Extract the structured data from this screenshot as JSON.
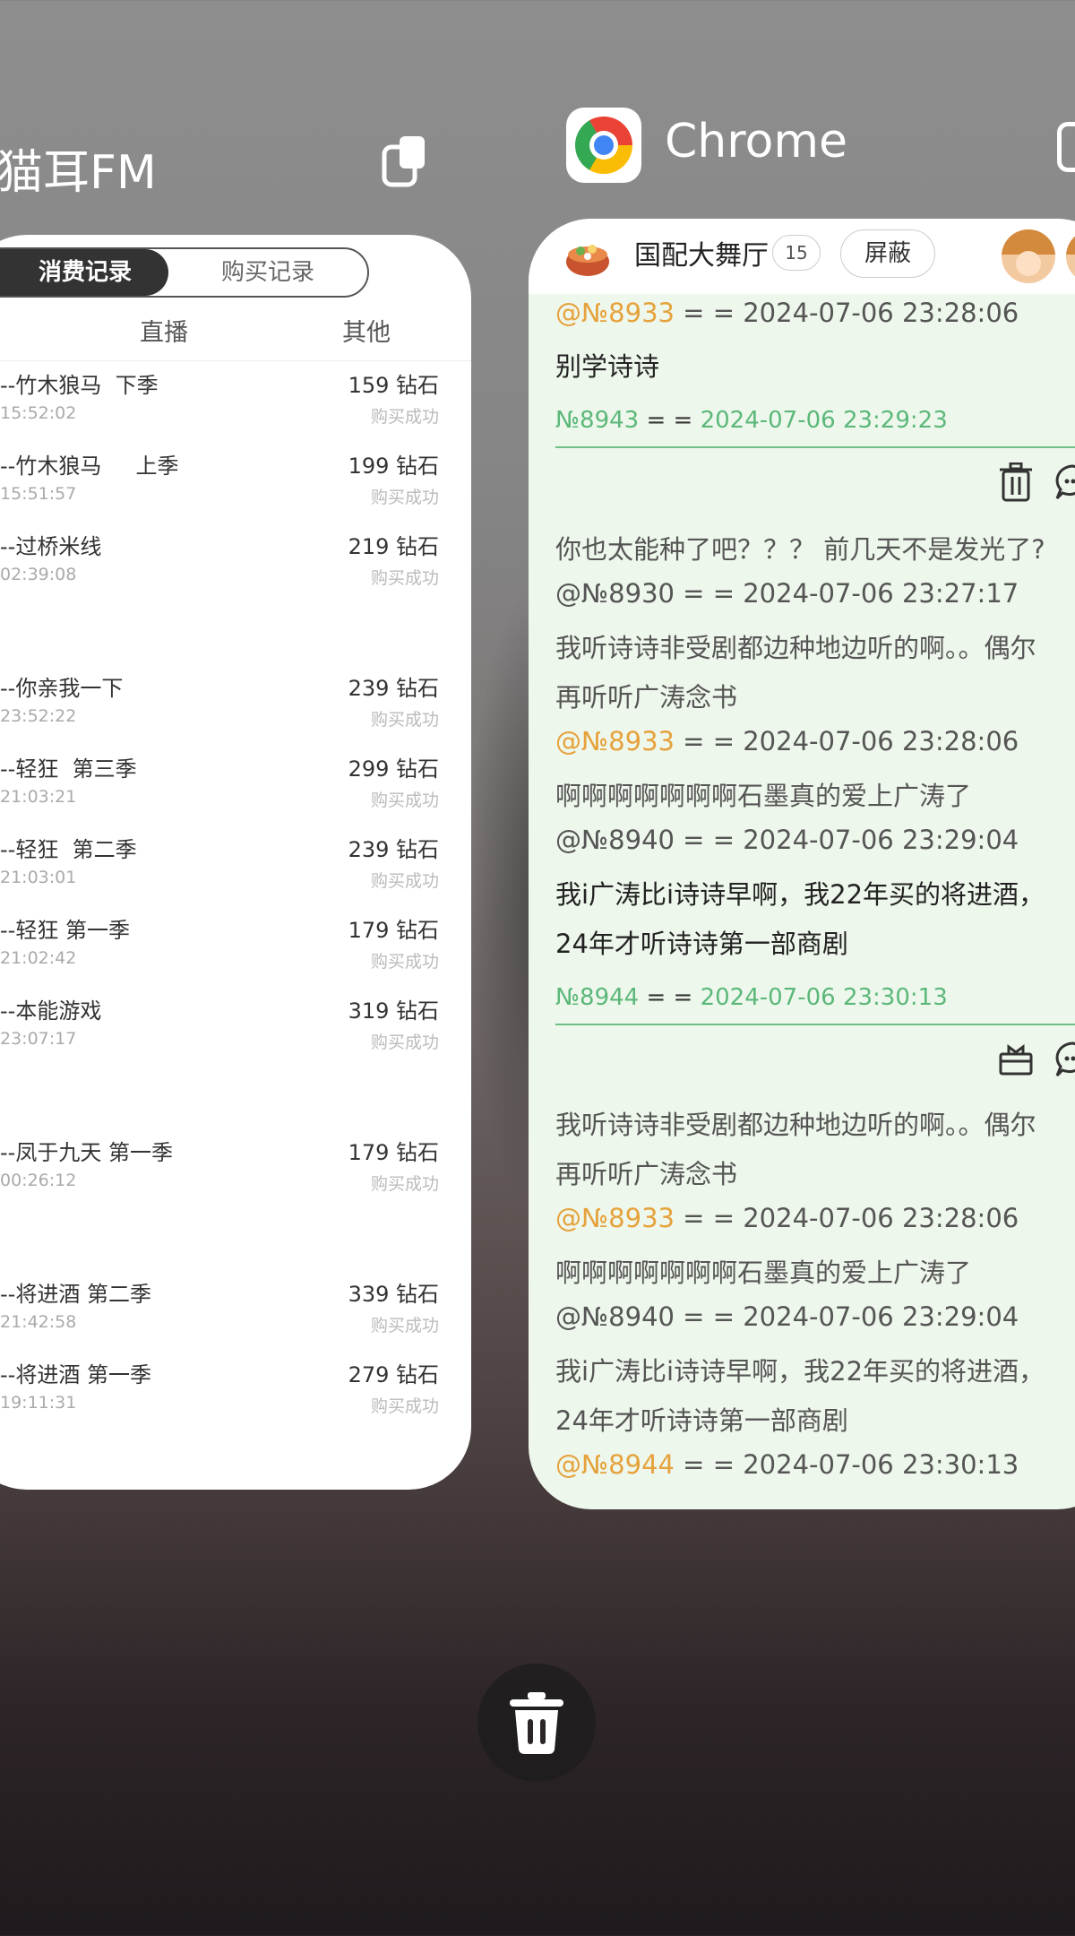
{
  "left_app": {
    "title": "猫耳FM",
    "tabs": {
      "active": "消费记录",
      "inactive": "购买记录"
    },
    "subtabs": [
      "直播",
      "其他"
    ],
    "records": [
      {
        "name": "--竹木狼马  下季",
        "amount": "159 钻石",
        "time": "15:52:02",
        "status": "购买成功"
      },
      {
        "name": "--竹木狼马     上季",
        "amount": "199 钻石",
        "time": "15:51:57",
        "status": "购买成功"
      },
      {
        "name": "--过桥米线",
        "amount": "219 钻石",
        "time": "02:39:08",
        "status": "购买成功"
      },
      {
        "name": "--你亲我一下",
        "amount": "239 钻石",
        "time": "23:52:22",
        "status": "购买成功"
      },
      {
        "name": "--轻狂  第三季",
        "amount": "299 钻石",
        "time": "21:03:21",
        "status": "购买成功"
      },
      {
        "name": "--轻狂  第二季",
        "amount": "239 钻石",
        "time": "21:03:01",
        "status": "购买成功"
      },
      {
        "name": "--轻狂 第一季",
        "amount": "179 钻石",
        "time": "21:02:42",
        "status": "购买成功"
      },
      {
        "name": "--本能游戏",
        "amount": "319 钻石",
        "time": "23:07:17",
        "status": "购买成功"
      },
      {
        "name": "--凤于九天 第一季",
        "amount": "179 钻石",
        "time": "00:26:12",
        "status": "购买成功"
      },
      {
        "name": "--将进酒 第二季",
        "amount": "339 钻石",
        "time": "21:42:58",
        "status": "购买成功"
      },
      {
        "name": "--将进酒 第一季",
        "amount": "279 钻石",
        "time": "19:11:31",
        "status": "购买成功"
      }
    ]
  },
  "right_app": {
    "title": "Chrome",
    "room": {
      "name": "国配大舞厅",
      "count": "15",
      "block_label": "屏蔽"
    },
    "lines": {
      "q1_id": "@№8933",
      "q1_rest": " = = 2024-07-06 23:28:06",
      "q1_text": "别学诗诗",
      "m1_id": "№8943",
      "m1_eq": " = = ",
      "m1_time": "2024-07-06 23:29:23",
      "t1": "你也太能种了吧？？？ 前几天不是发光了?",
      "t2": "@№8930 = = 2024-07-06 23:27:17",
      "t3": "我听诗诗非受剧都边种地边听的啊。。偶尔",
      "t4": "再听听广涛念书",
      "t5_id": "@№8933",
      "t5_rest": " = = 2024-07-06 23:28:06",
      "t6": "啊啊啊啊啊啊啊石墨真的爱上广涛了",
      "t7": "@№8940 = = 2024-07-06 23:29:04",
      "t8": "我i广涛比i诗诗早啊，我22年买的将进酒，",
      "t9": "24年才听诗诗第一部商剧",
      "m2_id": "№8944",
      "m2_eq": " = = ",
      "m2_time": "2024-07-06 23:30:13",
      "u1": "我听诗诗非受剧都边种地边听的啊。。偶尔",
      "u2": "再听听广涛念书",
      "u3_id": "@№8933",
      "u3_rest": " = = 2024-07-06 23:28:06",
      "u4": "啊啊啊啊啊啊啊石墨真的爱上广涛了",
      "u5": "@№8940 = = 2024-07-06 23:29:04",
      "u6": "我i广涛比i诗诗早啊，我22年买的将进酒，",
      "u7": "24年才听诗诗第一部商剧",
      "u8_id": "@№8944",
      "u8_rest": " = = 2024-07-06 23:30:13"
    }
  },
  "colors": {
    "orange": "#e6a23c",
    "green": "#5cb87a",
    "card_green_bg": "#eef7ec"
  },
  "icons": [
    "split-screen-icon",
    "chrome-logo-icon",
    "hotpot-icon",
    "trash-icon",
    "reply-icon",
    "gift-icon",
    "clear-all-trash-icon"
  ]
}
